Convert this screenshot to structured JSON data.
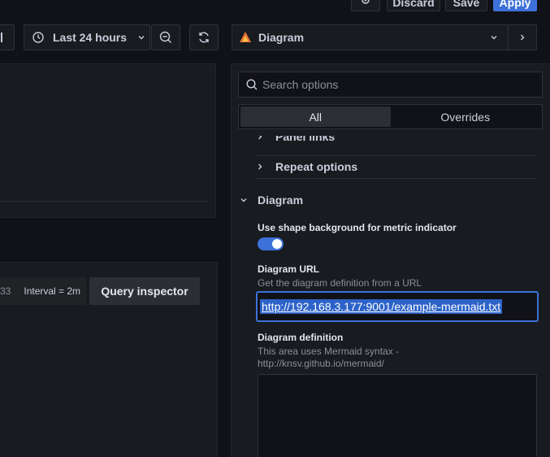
{
  "top_actions": {
    "discard_label": "Discard",
    "save_label": "Save",
    "apply_label": "Apply"
  },
  "toolbar": {
    "time_range": "Last 24 hours",
    "visualization": "Diagram"
  },
  "query": {
    "partial_text": "33",
    "interval": "Interval = 2m",
    "inspector_label": "Query inspector"
  },
  "options": {
    "search_placeholder": "Search options",
    "tabs": [
      {
        "label": "All"
      },
      {
        "label": "Overrides"
      }
    ],
    "panel_links_label": "Panel links",
    "repeat_options_label": "Repeat options",
    "diagram_section_label": "Diagram",
    "shape_bg_label": "Use shape background for metric indicator",
    "shape_bg_enabled": true,
    "url_label": "Diagram URL",
    "url_description": "Get the diagram definition from a URL",
    "url_value": "http://192.168.3.177:9001/example-mermaid.txt",
    "definition_label": "Diagram definition",
    "definition_desc_1": "This area uses Mermaid syntax -",
    "definition_desc_2": "http://knsv.github.io/mermaid/"
  },
  "colors": {
    "accent": "#3d71d9",
    "apply": "#3d71d9",
    "background": "#111217",
    "panel": "#181b1f"
  }
}
